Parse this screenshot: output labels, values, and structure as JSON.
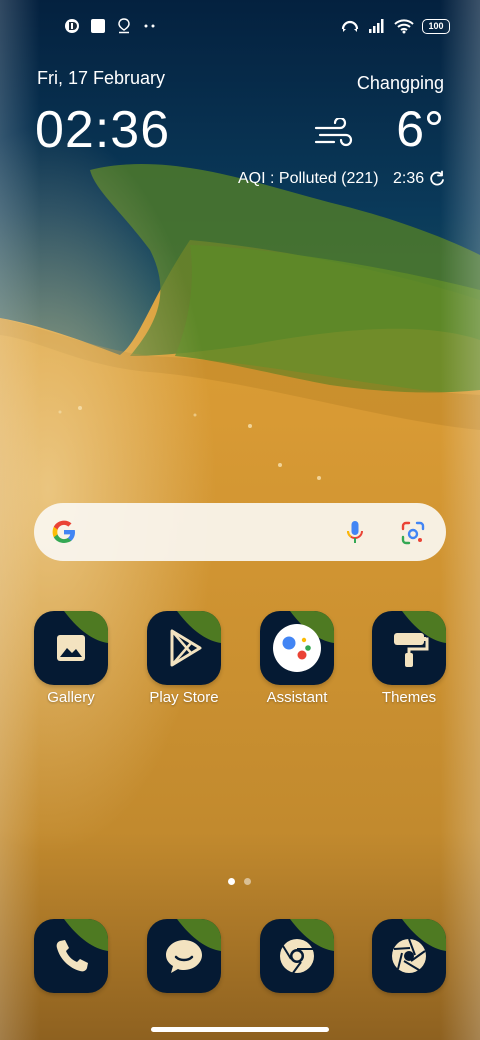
{
  "status_bar": {
    "left_icons": [
      "notification-app-icon",
      "square-notification-icon",
      "location-pin-icon",
      "more-dots-icon"
    ],
    "right_icons": [
      "data-sync-icon",
      "signal-icon",
      "wifi-icon"
    ],
    "battery": "100"
  },
  "clock_widget": {
    "date": "Fri, 17 February",
    "time": "02:36",
    "city": "Changping",
    "temperature": "6°",
    "weather_icon": "wind-icon",
    "aqi": "AQI : Polluted (221)",
    "updated": "2:36"
  },
  "search": {
    "icons": [
      "google-logo",
      "mic-icon",
      "lens-icon"
    ]
  },
  "apps": [
    {
      "label": "Gallery",
      "icon": "gallery-icon"
    },
    {
      "label": "Play Store",
      "icon": "play-store-icon"
    },
    {
      "label": "Assistant",
      "icon": "assistant-icon"
    },
    {
      "label": "Themes",
      "icon": "themes-icon"
    }
  ],
  "dock": [
    {
      "icon": "phone-icon"
    },
    {
      "icon": "messages-icon"
    },
    {
      "icon": "chrome-icon"
    },
    {
      "icon": "camera-icon"
    }
  ],
  "page_indicator": {
    "pages": 2,
    "current": 1
  },
  "colors": {
    "icon_bg": "#051a33",
    "icon_glyph": "#f3e3c0",
    "icon_accent_green": "#4e7a22",
    "google_blue": "#4285F4",
    "google_red": "#EA4335",
    "google_yellow": "#FBBC05",
    "google_green": "#34A853"
  }
}
